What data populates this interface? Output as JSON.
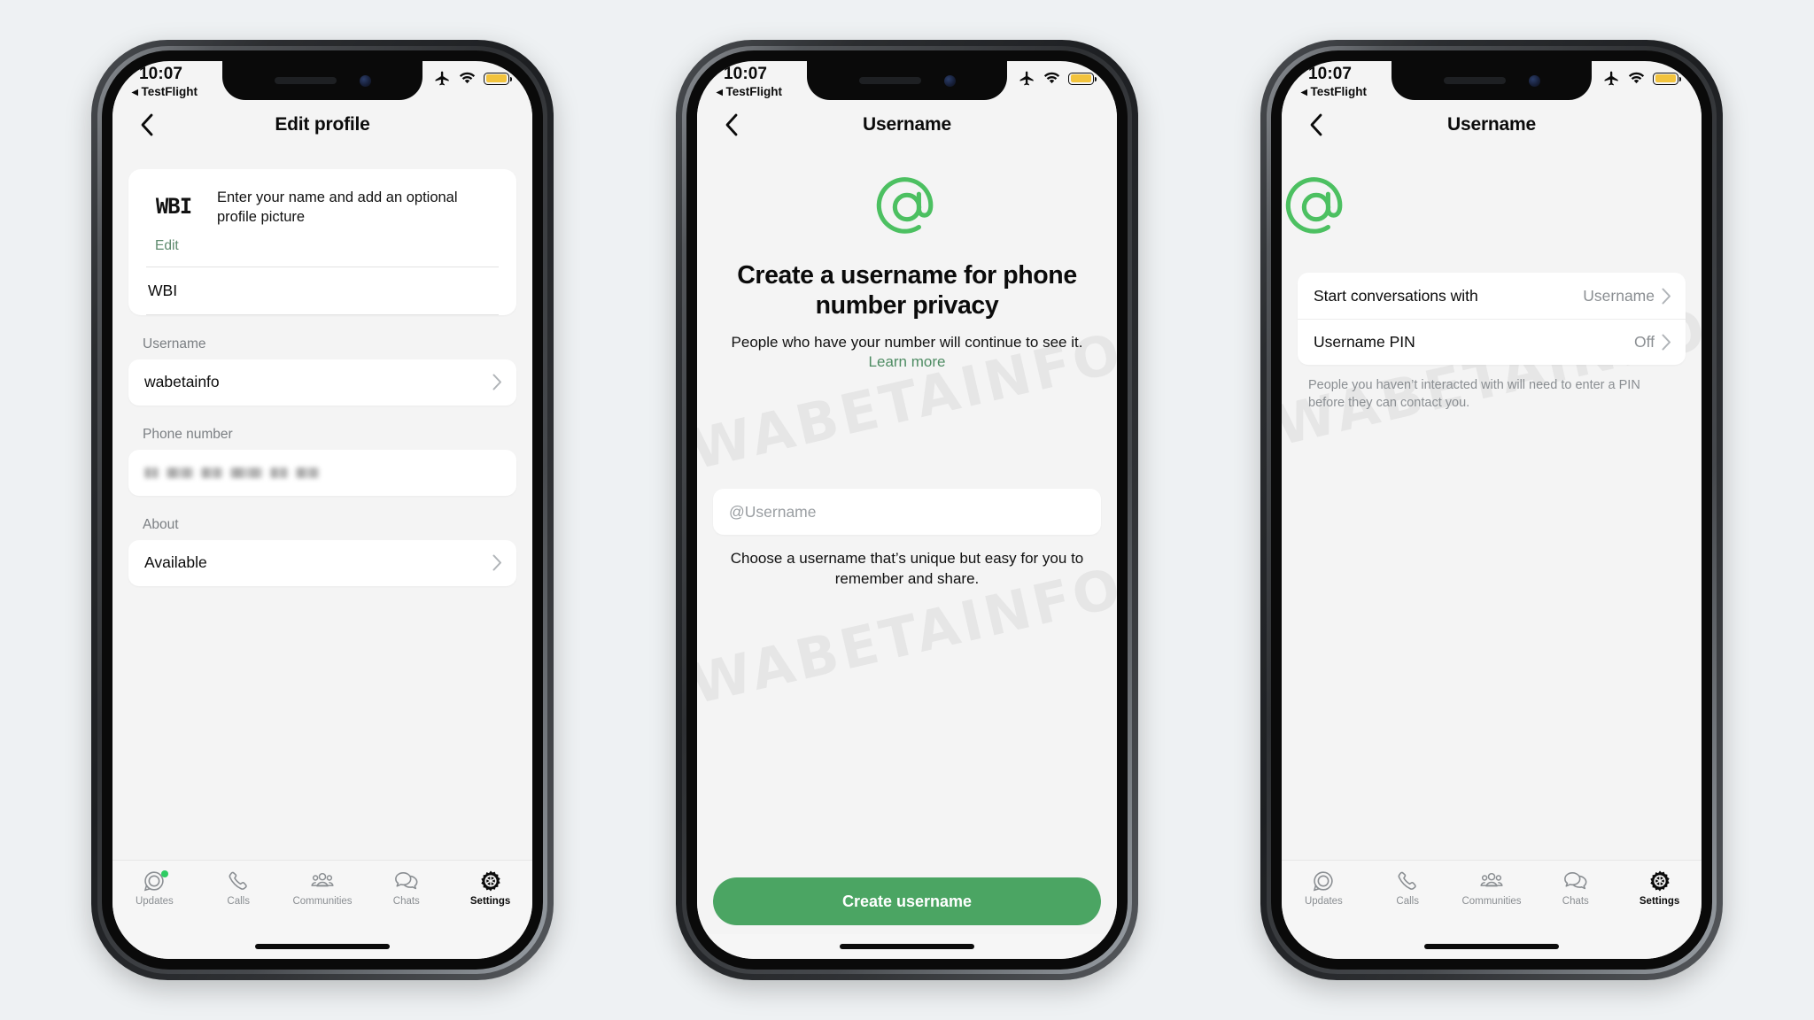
{
  "background_color": "#eef1f3",
  "accent_green": "#4ba563",
  "icon_green": "#4cc061",
  "link_green": "#4e8c63",
  "watermark": "WABETAINFO",
  "status_bar": {
    "time": "10:07",
    "back_app": "◂ TestFlight",
    "icons": [
      "airplane-mode-icon",
      "wifi-icon",
      "battery-icon"
    ],
    "battery_color": "#f2c33d"
  },
  "tab_bar": {
    "items": [
      {
        "label": "Updates",
        "icon": "updates-icon",
        "active": false,
        "badge_dot": true
      },
      {
        "label": "Calls",
        "icon": "phone-icon",
        "active": false,
        "badge_dot": false
      },
      {
        "label": "Communities",
        "icon": "communities-icon",
        "active": false,
        "badge_dot": false
      },
      {
        "label": "Chats",
        "icon": "chats-icon",
        "active": false,
        "badge_dot": false
      },
      {
        "label": "Settings",
        "icon": "gear-icon",
        "active": true,
        "badge_dot": false
      }
    ]
  },
  "phone1": {
    "nav_title": "Edit profile",
    "profile": {
      "avatar_text": "WBI",
      "hint": "Enter your name and add an optional profile picture",
      "edit_label": "Edit",
      "name_value": "WBI"
    },
    "username_group_label": "Username",
    "username_value": "wabetainfo",
    "phone_group_label": "Phone number",
    "phone_value_redacted": true,
    "about_group_label": "About",
    "about_value": "Available"
  },
  "phone2": {
    "nav_title": "Username",
    "icon": "at-sign-icon",
    "title": "Create a username for phone number privacy",
    "subtitle": "People who have your number will continue to see it.",
    "subtitle_link": "Learn more",
    "input_placeholder": "@Username",
    "input_value": "",
    "helper_text": "Choose a username that’s unique but easy for you to remember and share.",
    "primary_button": "Create username"
  },
  "phone3": {
    "nav_title": "Username",
    "icon": "at-sign-icon",
    "rows": [
      {
        "label": "Start conversations with",
        "value": "Username"
      },
      {
        "label": "Username PIN",
        "value": "Off"
      }
    ],
    "footer": "People you haven’t interacted with will need to enter a PIN before they can contact you."
  }
}
